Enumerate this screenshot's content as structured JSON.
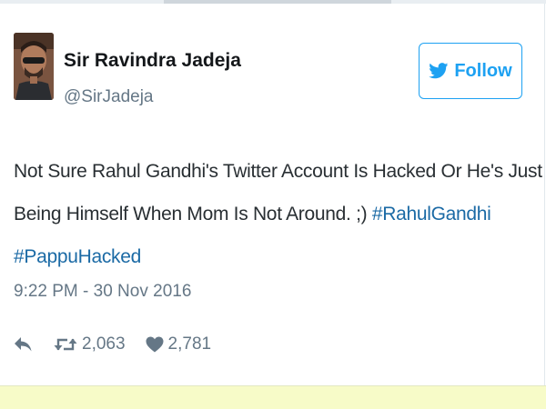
{
  "author": {
    "display_name": "Sir Ravindra Jadeja",
    "handle": "@SirJadeja"
  },
  "follow_button": {
    "label": "Follow",
    "icon": "twitter-bird-icon"
  },
  "tweet": {
    "line1": "Not Sure Rahul Gandhi's Twitter Account Is Hacked Or He's Just",
    "line2_text": "Being Himself When Mom Is Not Around. ;) ",
    "hashtag1": "#RahulGandhi",
    "hashtag2": "#PappuHacked",
    "timestamp": "9:22 PM - 30 Nov 2016"
  },
  "actions": {
    "reply_icon": "reply-icon",
    "retweet_icon": "retweet-icon",
    "retweet_count": "2,063",
    "like_icon": "heart-icon",
    "like_count": "2,781"
  },
  "colors": {
    "brand_blue": "#1da1f2",
    "hashtag_blue": "#1b6aa5",
    "muted_gray": "#657786",
    "text_dark": "#292f33",
    "bottom_band": "#f7fbc8"
  }
}
